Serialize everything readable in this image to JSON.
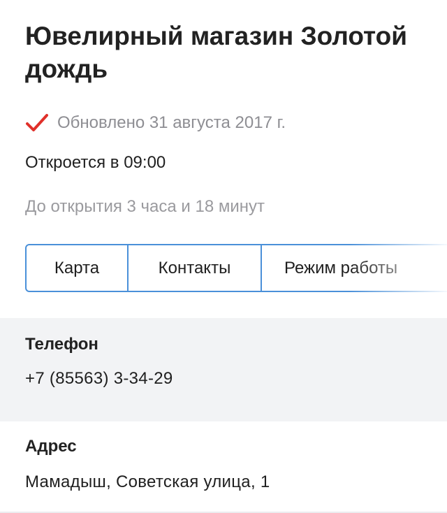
{
  "shop": {
    "title": "Ювелирный магазин Золотой дождь",
    "updated": "Обновлено 31 августа 2017 г.",
    "opens": "Откроется в 09:00",
    "until_open": "До открытия 3 часа и 18 минут"
  },
  "tabs": [
    {
      "label": "Карта"
    },
    {
      "label": "Контакты"
    },
    {
      "label": "Режим работы"
    }
  ],
  "contacts": {
    "phone_label": "Телефон",
    "phone_value": "+7 (85563) 3-34-29",
    "address_label": "Адрес",
    "address_value": "Мамадыш, Советская улица, 1"
  },
  "colors": {
    "accent_blue": "#4a90d9",
    "check_red": "#e0302a",
    "muted_text": "#8e8e93",
    "section_bg": "#f2f3f5"
  },
  "icons": {
    "updated": "check-icon"
  }
}
